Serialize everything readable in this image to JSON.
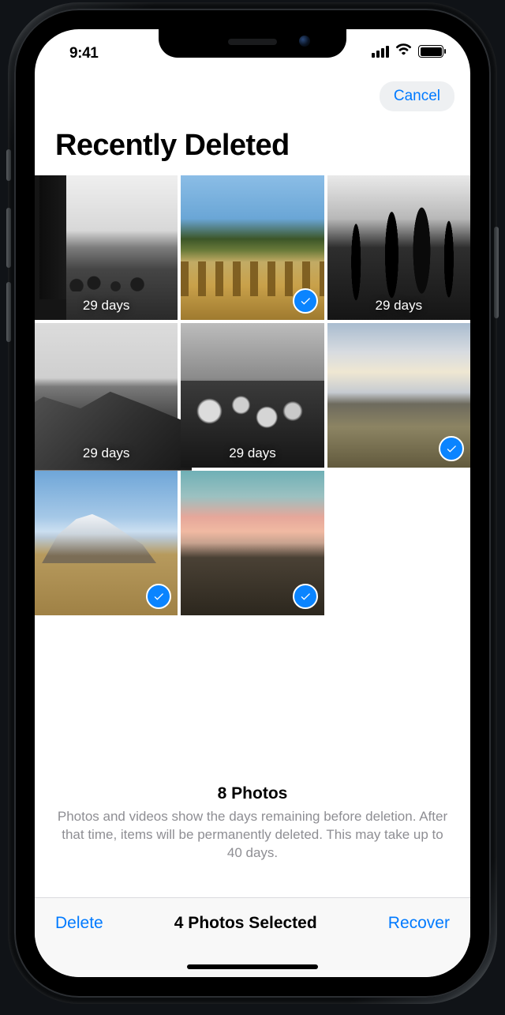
{
  "statusbar": {
    "time": "9:41"
  },
  "nav": {
    "cancel_label": "Cancel"
  },
  "page": {
    "title": "Recently Deleted"
  },
  "grid": {
    "items": [
      {
        "days": "29 days",
        "selected": false
      },
      {
        "days": "",
        "selected": true
      },
      {
        "days": "29 days",
        "selected": false
      },
      {
        "days": "29 days",
        "selected": false
      },
      {
        "days": "29 days",
        "selected": false
      },
      {
        "days": "",
        "selected": true
      },
      {
        "days": "",
        "selected": true
      },
      {
        "days": "",
        "selected": true
      }
    ]
  },
  "info": {
    "count_label": "8 Photos",
    "description": "Photos and videos show the days remaining before deletion. After that time, items will be permanently deleted. This may take up to 40 days."
  },
  "toolbar": {
    "delete_label": "Delete",
    "status_label": "4 Photos Selected",
    "recover_label": "Recover"
  }
}
